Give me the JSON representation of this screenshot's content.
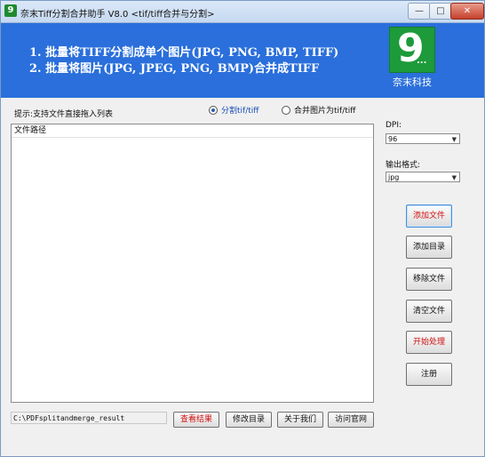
{
  "window": {
    "title": "奈末Tiff分割合并助手 V8.0 <tif/tiff合并与分割>",
    "controls": {
      "minimize": "—",
      "maximize": "□",
      "close": "✕"
    }
  },
  "banner": {
    "line1": "1. 批量将TIFF分割成单个图片(JPG, PNG, BMP, TIFF)",
    "line2": "2. 批量将图片(JPG, JPEG, PNG, BMP)合并成TIFF",
    "logo_mark": "9",
    "logo_dots": "...",
    "logo_text": "奈末科技"
  },
  "hint": "提示:支持文件直接拖入列表",
  "mode_options": [
    {
      "label": "分割tif/tiff",
      "selected": true
    },
    {
      "label": "合并图片为tif/tiff",
      "selected": false
    }
  ],
  "file_list": {
    "column_header": "文件路径"
  },
  "settings": {
    "dpi_label": "DPI:",
    "dpi_value": "96",
    "format_label": "输出格式:",
    "format_value": "jpg"
  },
  "side_buttons": {
    "add_file": "添加文件",
    "add_folder": "添加目录",
    "remove_file": "移除文件",
    "clear_files": "清空文件",
    "start": "开始处理",
    "register": "注册"
  },
  "output": {
    "path": "C:\\PDFsplitandmerge_result",
    "view_result": "查看结果",
    "change_dir": "修改目录",
    "about": "关于我们",
    "website": "访问官网"
  },
  "colors": {
    "banner": "#2a6fdb",
    "logo": "#1d9a3a",
    "accent_red": "#d01010"
  }
}
